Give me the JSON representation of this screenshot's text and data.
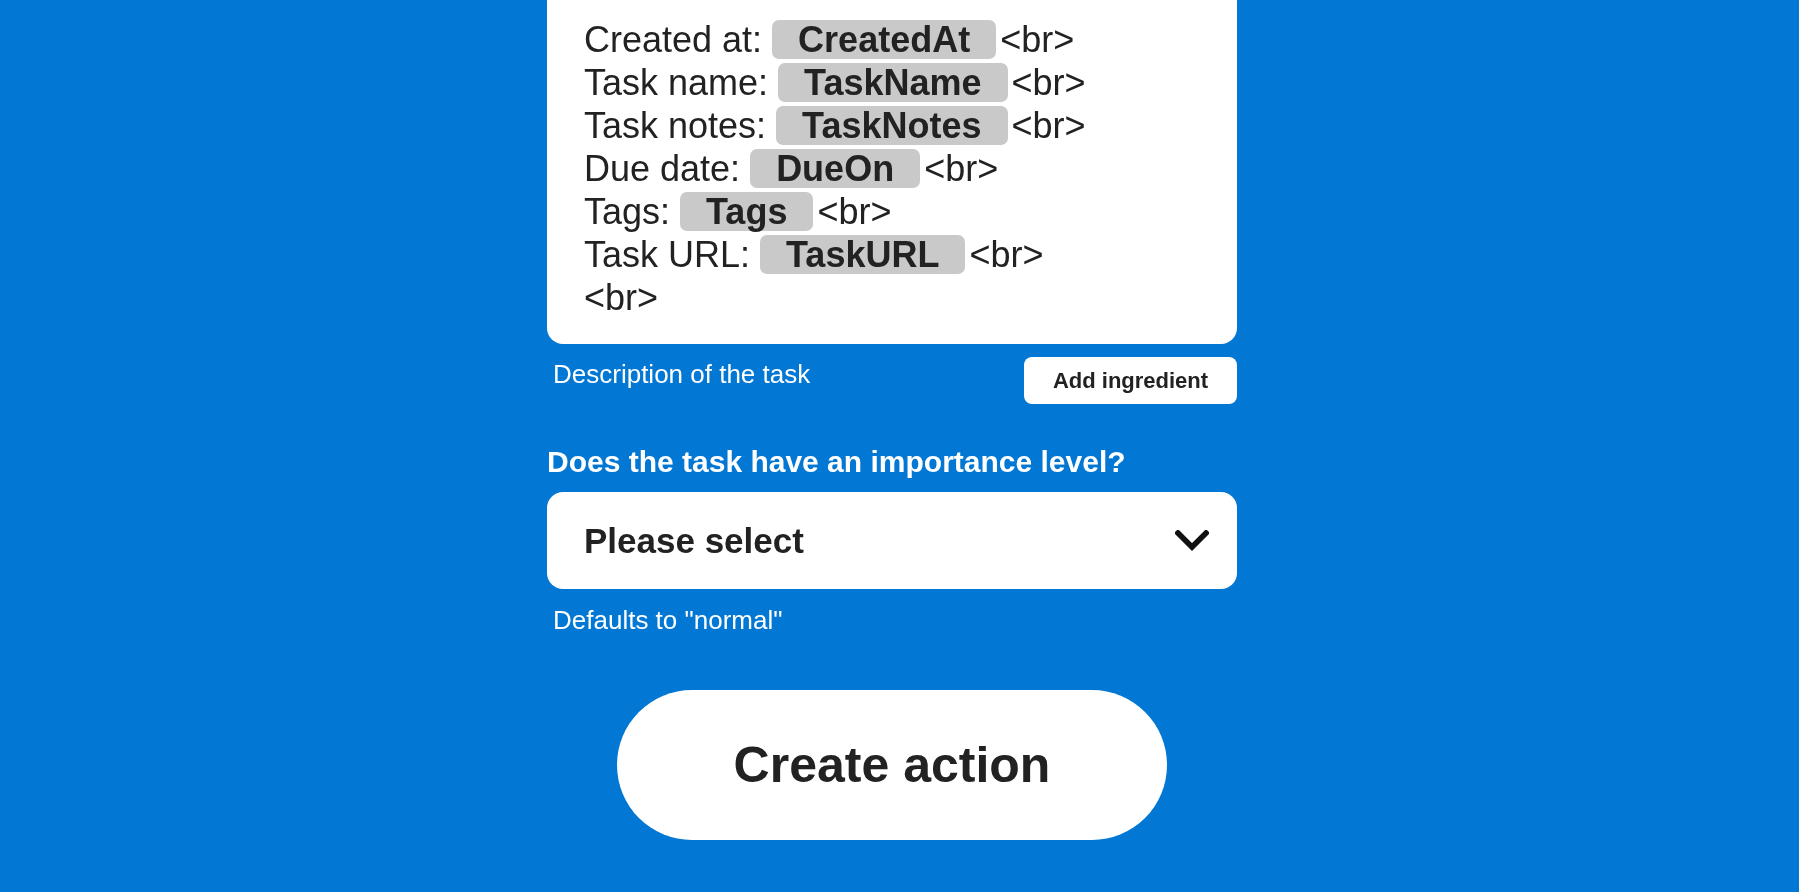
{
  "body_field": {
    "lines": [
      {
        "label": "Created at:",
        "ingredient": "CreatedAt",
        "tail": "<br>"
      },
      {
        "label": "Task name:",
        "ingredient": "TaskName",
        "tail": "<br>"
      },
      {
        "label": "Task notes:",
        "ingredient": "TaskNotes",
        "tail": "<br>"
      },
      {
        "label": "Due date:",
        "ingredient": "DueOn",
        "tail": "<br>"
      },
      {
        "label": "Tags:",
        "ingredient": "Tags",
        "tail": "<br>"
      },
      {
        "label": "Task URL:",
        "ingredient": "TaskURL",
        "tail": "<br>"
      },
      {
        "tail": "<br>"
      }
    ],
    "hint": "Description of the task",
    "add_button": "Add ingredient"
  },
  "importance_field": {
    "label": "Does the task have an importance level?",
    "value": "Please select",
    "hint": "Defaults to \"normal\""
  },
  "submit_button": "Create action"
}
